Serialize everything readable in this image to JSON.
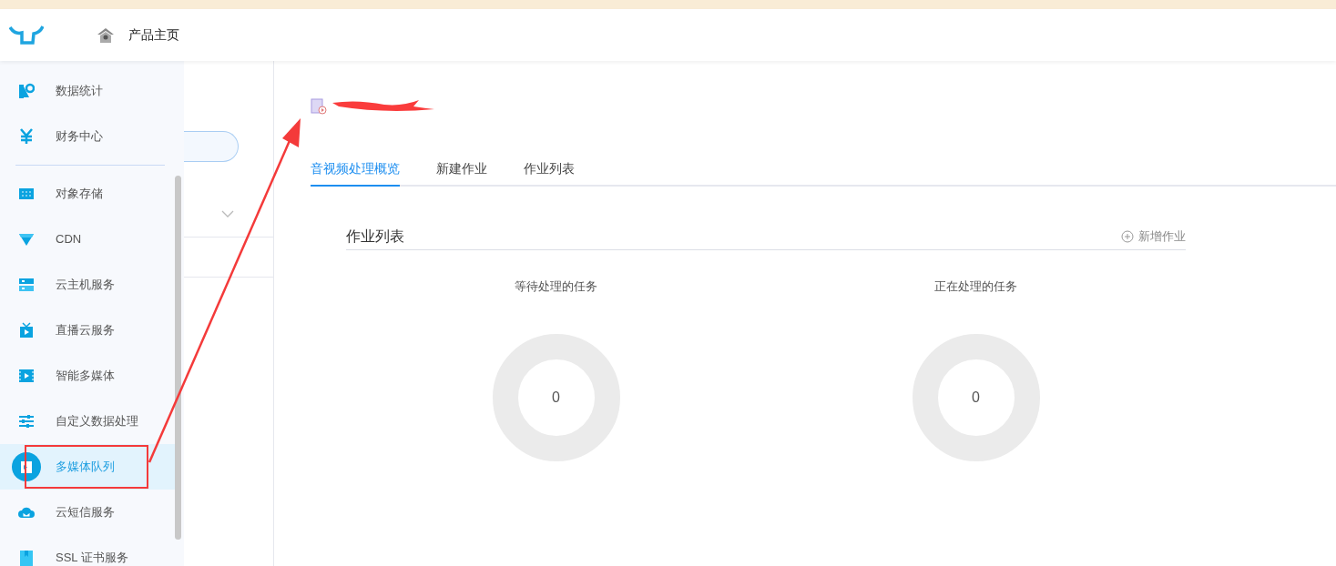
{
  "header": {
    "home_link": "产品主页"
  },
  "sidebar": {
    "items": [
      {
        "label": "数据统计",
        "selected": false
      },
      {
        "label": "财务中心",
        "selected": false
      },
      {
        "label": "对象存储",
        "selected": false
      },
      {
        "label": "CDN",
        "selected": false
      },
      {
        "label": "云主机服务",
        "selected": false
      },
      {
        "label": "直播云服务",
        "selected": false
      },
      {
        "label": "智能多媒体",
        "selected": false
      },
      {
        "label": "自定义数据处理",
        "selected": false
      },
      {
        "label": "多媒体队列",
        "selected": true
      },
      {
        "label": "云短信服务",
        "selected": false
      },
      {
        "label": "SSL 证书服务",
        "selected": false
      }
    ]
  },
  "tabs": [
    {
      "label": "音视频处理概览",
      "selected": true
    },
    {
      "label": "新建作业",
      "selected": false
    },
    {
      "label": "作业列表",
      "selected": false
    }
  ],
  "section": {
    "title": "作业列表",
    "action": "新增作业"
  },
  "stats": [
    {
      "label": "等待处理的任务",
      "value": "0"
    },
    {
      "label": "正在处理的任务",
      "value": "0"
    }
  ]
}
